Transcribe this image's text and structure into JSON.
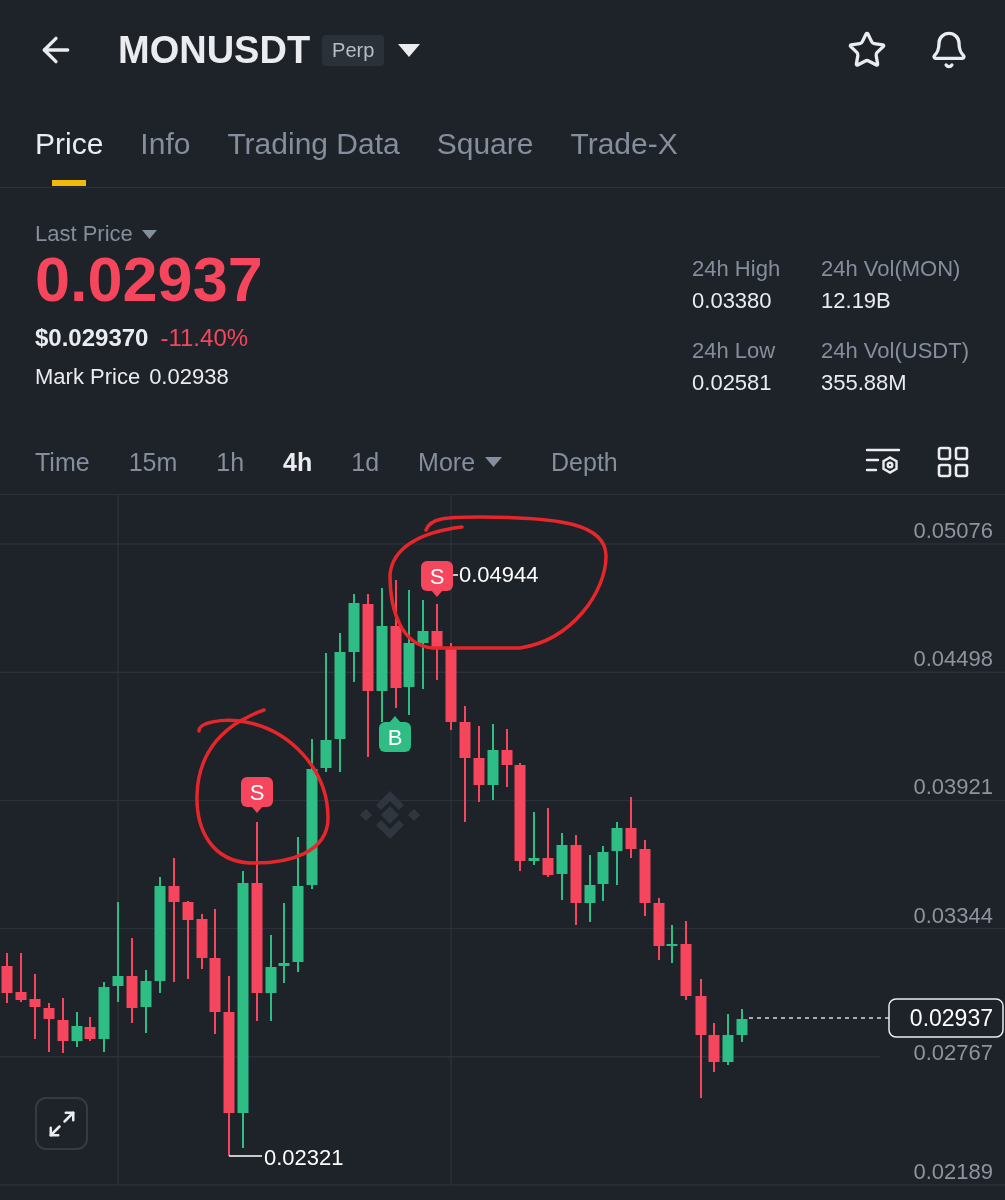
{
  "header": {
    "symbol": "MONUSDT",
    "badge": "Perp"
  },
  "tabs": [
    {
      "label": "Price",
      "selected": true
    },
    {
      "label": "Info",
      "selected": false
    },
    {
      "label": "Trading Data",
      "selected": false
    },
    {
      "label": "Square",
      "selected": false
    },
    {
      "label": "Trade-X",
      "selected": false
    }
  ],
  "ticker": {
    "last_price_label": "Last Price",
    "last_price": "0.02937",
    "usd_price": "$0.029370",
    "change": "-11.40%",
    "mark_price_label": "Mark Price",
    "mark_price": "0.02938",
    "stats": [
      {
        "label": "24h High",
        "value": "0.03380"
      },
      {
        "label": "24h Vol(MON)",
        "value": "12.19B"
      },
      {
        "label": "24h Low",
        "value": "0.02581"
      },
      {
        "label": "24h Vol(USDT)",
        "value": "355.88M"
      }
    ]
  },
  "intervals": [
    {
      "label": "Time",
      "selected": false
    },
    {
      "label": "15m",
      "selected": false
    },
    {
      "label": "1h",
      "selected": false
    },
    {
      "label": "4h",
      "selected": true
    },
    {
      "label": "1d",
      "selected": false
    }
  ],
  "more": "More",
  "depth": "Depth",
  "chart": {
    "price_axis": [
      "0.05076",
      "0.04498",
      "0.03921",
      "0.03344",
      "0.02767",
      "0.02189"
    ],
    "current_price": "0.02937",
    "high": "0.04944",
    "low": "0.02321",
    "markers": [
      {
        "kind": "sell",
        "text": "S"
      },
      {
        "kind": "buy",
        "text": "B"
      },
      {
        "kind": "sell",
        "text": "S"
      }
    ]
  }
}
